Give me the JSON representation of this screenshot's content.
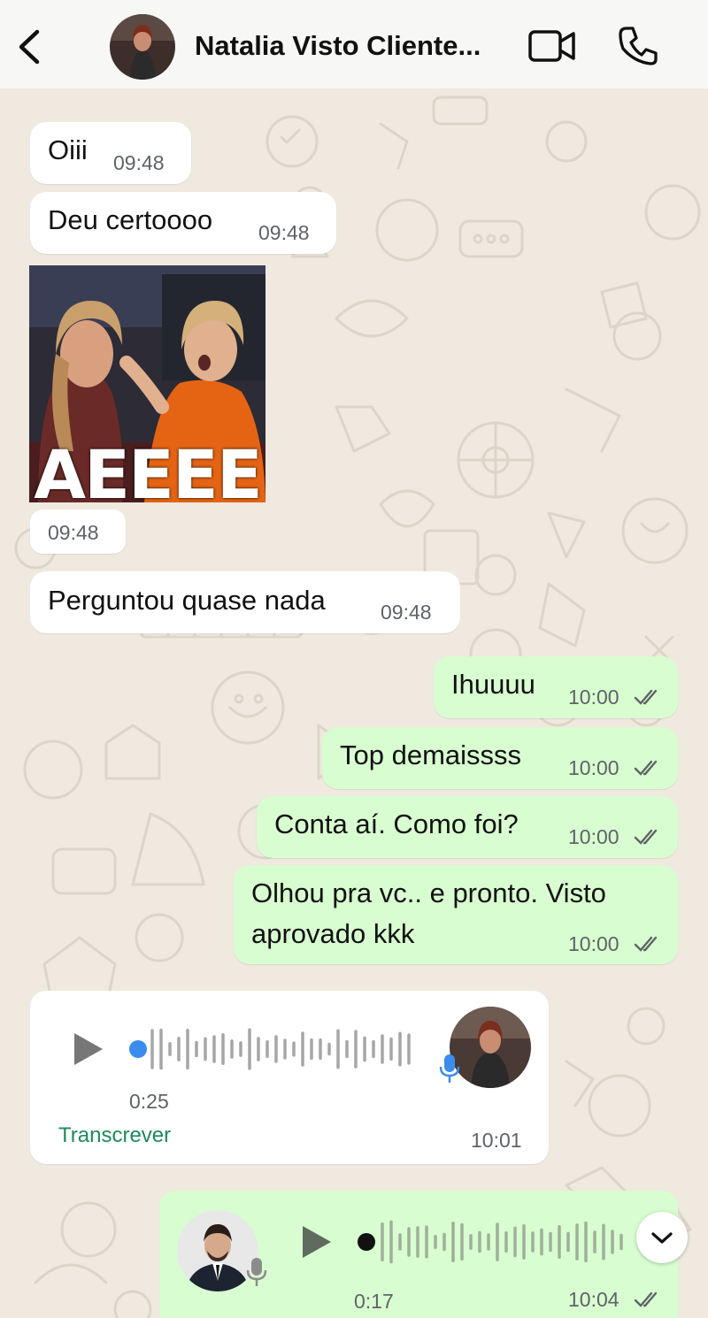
{
  "header": {
    "title": "Natalia Visto Cliente...",
    "icons": [
      "back-arrow",
      "video-call",
      "voice-call"
    ]
  },
  "messages": [
    {
      "direction": "in",
      "text": "Oiii",
      "time": "09:48"
    },
    {
      "direction": "in",
      "text": "Deu certoooo",
      "time": "09:48"
    },
    {
      "direction": "in",
      "type": "sticker",
      "sticker_text": "AEEEE",
      "time": "09:48"
    },
    {
      "direction": "in",
      "text": "Perguntou quase nada",
      "time": "09:48"
    },
    {
      "direction": "out",
      "text": "Ihuuuu",
      "time": "10:00",
      "status": "read"
    },
    {
      "direction": "out",
      "text": "Top demaissss",
      "time": "10:00",
      "status": "read"
    },
    {
      "direction": "out",
      "text": "Conta aí. Como foi?",
      "time": "10:00",
      "status": "read"
    },
    {
      "direction": "out",
      "text_line1": "Olhou pra vc.. e pronto. Visto",
      "text_line2": "aprovado kkk",
      "time": "10:00",
      "status": "read"
    }
  ],
  "voice_in": {
    "duration": "0:25",
    "time": "10:01",
    "transcribe_label": "Transcrever",
    "progress": 0
  },
  "voice_out": {
    "duration": "0:17",
    "time": "10:04",
    "status": "read",
    "progress": 0
  },
  "colors": {
    "incoming": "#ffffff",
    "outgoing": "#d8fdd0",
    "accent": "#1d8a5a",
    "played_dot": "#3b8ded"
  }
}
